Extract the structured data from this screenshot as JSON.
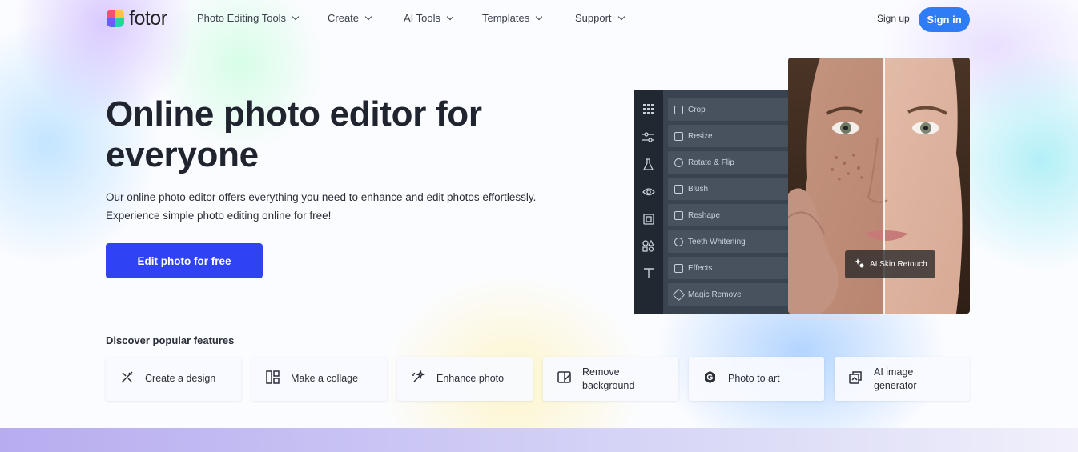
{
  "nav": {
    "logo_text": "fotor",
    "menu": [
      {
        "label": "Photo Editing Tools"
      },
      {
        "label": "Create"
      },
      {
        "label": "AI Tools"
      },
      {
        "label": "Templates"
      },
      {
        "label": "Support"
      }
    ],
    "signup_label": "Sign up",
    "signin_label": "Sign in"
  },
  "hero": {
    "title": "Online photo editor for everyone",
    "description": "Our online photo editor offers everything you need to enhance and edit photos effortlessly. Experience simple photo editing online for free!",
    "cta_label": "Edit photo for free"
  },
  "mockup": {
    "tools": [
      {
        "label": "Crop"
      },
      {
        "label": "Resize"
      },
      {
        "label": "Rotate & Flip"
      },
      {
        "label": "Blush"
      },
      {
        "label": "Reshape"
      },
      {
        "label": "Teeth Whitening"
      },
      {
        "label": "Effects"
      },
      {
        "label": "Magic Remove"
      }
    ],
    "rail_icons": [
      "grid-icon",
      "sliders-icon",
      "flask-icon",
      "eye-icon",
      "frame-icon",
      "shapes-icon",
      "text-icon"
    ],
    "badge_label": "AI Skin Retouch"
  },
  "features": {
    "title": "Discover popular features",
    "items": [
      {
        "label": "Create a design",
        "icon": "design-icon"
      },
      {
        "label": "Make a collage",
        "icon": "collage-icon"
      },
      {
        "label": "Enhance photo",
        "icon": "enhance-icon"
      },
      {
        "label": "Remove background",
        "icon": "remove-background-icon"
      },
      {
        "label": "Photo to art",
        "icon": "photo-to-art-icon"
      },
      {
        "label": "AI image generator",
        "icon": "ai-generator-icon"
      }
    ]
  },
  "colors": {
    "primary_cta": "#2f43f5",
    "signin": "#2e7cf6",
    "title_text": "#20242e"
  }
}
